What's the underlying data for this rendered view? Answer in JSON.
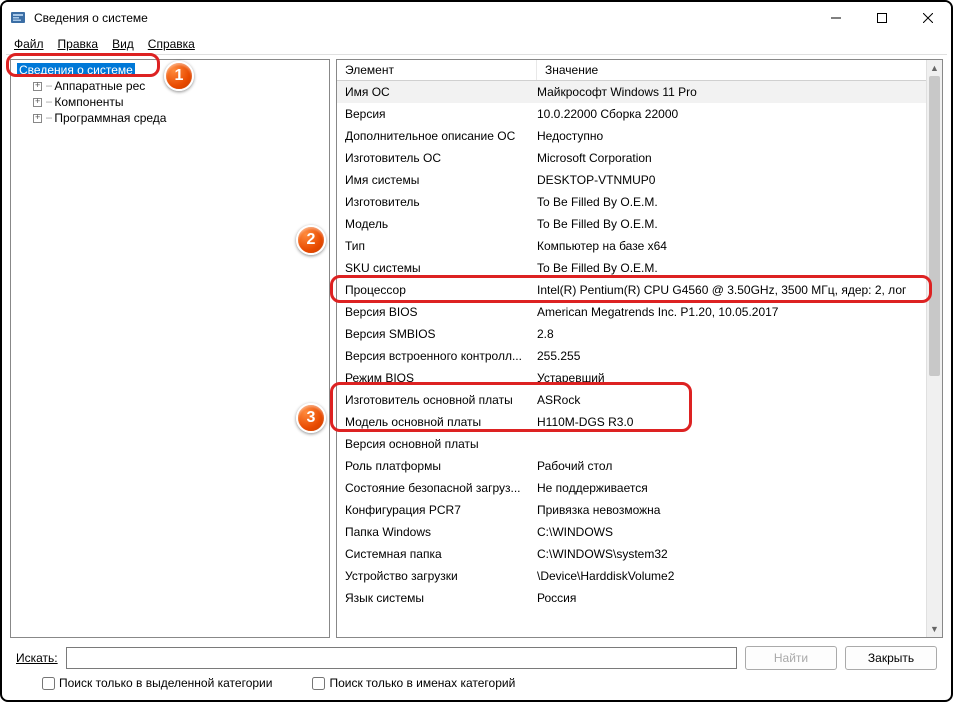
{
  "titlebar": {
    "title": "Сведения о системе"
  },
  "menu": {
    "file": "Файл",
    "edit": "Правка",
    "view": "Вид",
    "help": "Справка"
  },
  "tree": {
    "root": "Сведения о системе",
    "hw": "Аппаратные рес",
    "comp": "Компоненты",
    "env": "Программная среда"
  },
  "cols": {
    "element": "Элемент",
    "value": "Значение"
  },
  "rows": [
    {
      "k": "Имя ОС",
      "v": "Майкрософт Windows 11 Pro"
    },
    {
      "k": "Версия",
      "v": "10.0.22000 Сборка 22000"
    },
    {
      "k": "Дополнительное описание ОС",
      "v": "Недоступно"
    },
    {
      "k": "Изготовитель ОС",
      "v": "Microsoft Corporation"
    },
    {
      "k": "Имя системы",
      "v": "DESKTOP-VTNMUP0"
    },
    {
      "k": "Изготовитель",
      "v": "To Be Filled By O.E.M."
    },
    {
      "k": "Модель",
      "v": "To Be Filled By O.E.M."
    },
    {
      "k": "Тип",
      "v": "Компьютер на базе x64"
    },
    {
      "k": "SKU системы",
      "v": "To Be Filled By O.E.M."
    },
    {
      "k": "Процессор",
      "v": "Intel(R) Pentium(R) CPU G4560 @ 3.50GHz, 3500 МГц, ядер: 2, лог"
    },
    {
      "k": "Версия BIOS",
      "v": "American Megatrends Inc. P1.20, 10.05.2017"
    },
    {
      "k": "Версия SMBIOS",
      "v": "2.8"
    },
    {
      "k": "Версия встроенного контролл...",
      "v": "255.255"
    },
    {
      "k": "Режим BIOS",
      "v": "Устаревший"
    },
    {
      "k": "Изготовитель основной платы",
      "v": "ASRock"
    },
    {
      "k": "Модель основной платы",
      "v": "H110M-DGS R3.0"
    },
    {
      "k": "Версия основной платы",
      "v": ""
    },
    {
      "k": "Роль платформы",
      "v": "Рабочий стол"
    },
    {
      "k": "Состояние безопасной загруз...",
      "v": "Не поддерживается"
    },
    {
      "k": "Конфигурация PCR7",
      "v": "Привязка невозможна"
    },
    {
      "k": "Папка Windows",
      "v": "C:\\WINDOWS"
    },
    {
      "k": "Системная папка",
      "v": "C:\\WINDOWS\\system32"
    },
    {
      "k": "Устройство загрузки",
      "v": "\\Device\\HarddiskVolume2"
    },
    {
      "k": "Язык системы",
      "v": "Россия"
    }
  ],
  "search": {
    "label": "Искать:",
    "find": "Найти",
    "close": "Закрыть",
    "chk1": "Поиск только в выделенной категории",
    "chk2": "Поиск только в именах категорий"
  },
  "badges": {
    "b1": "1",
    "b2": "2",
    "b3": "3"
  }
}
